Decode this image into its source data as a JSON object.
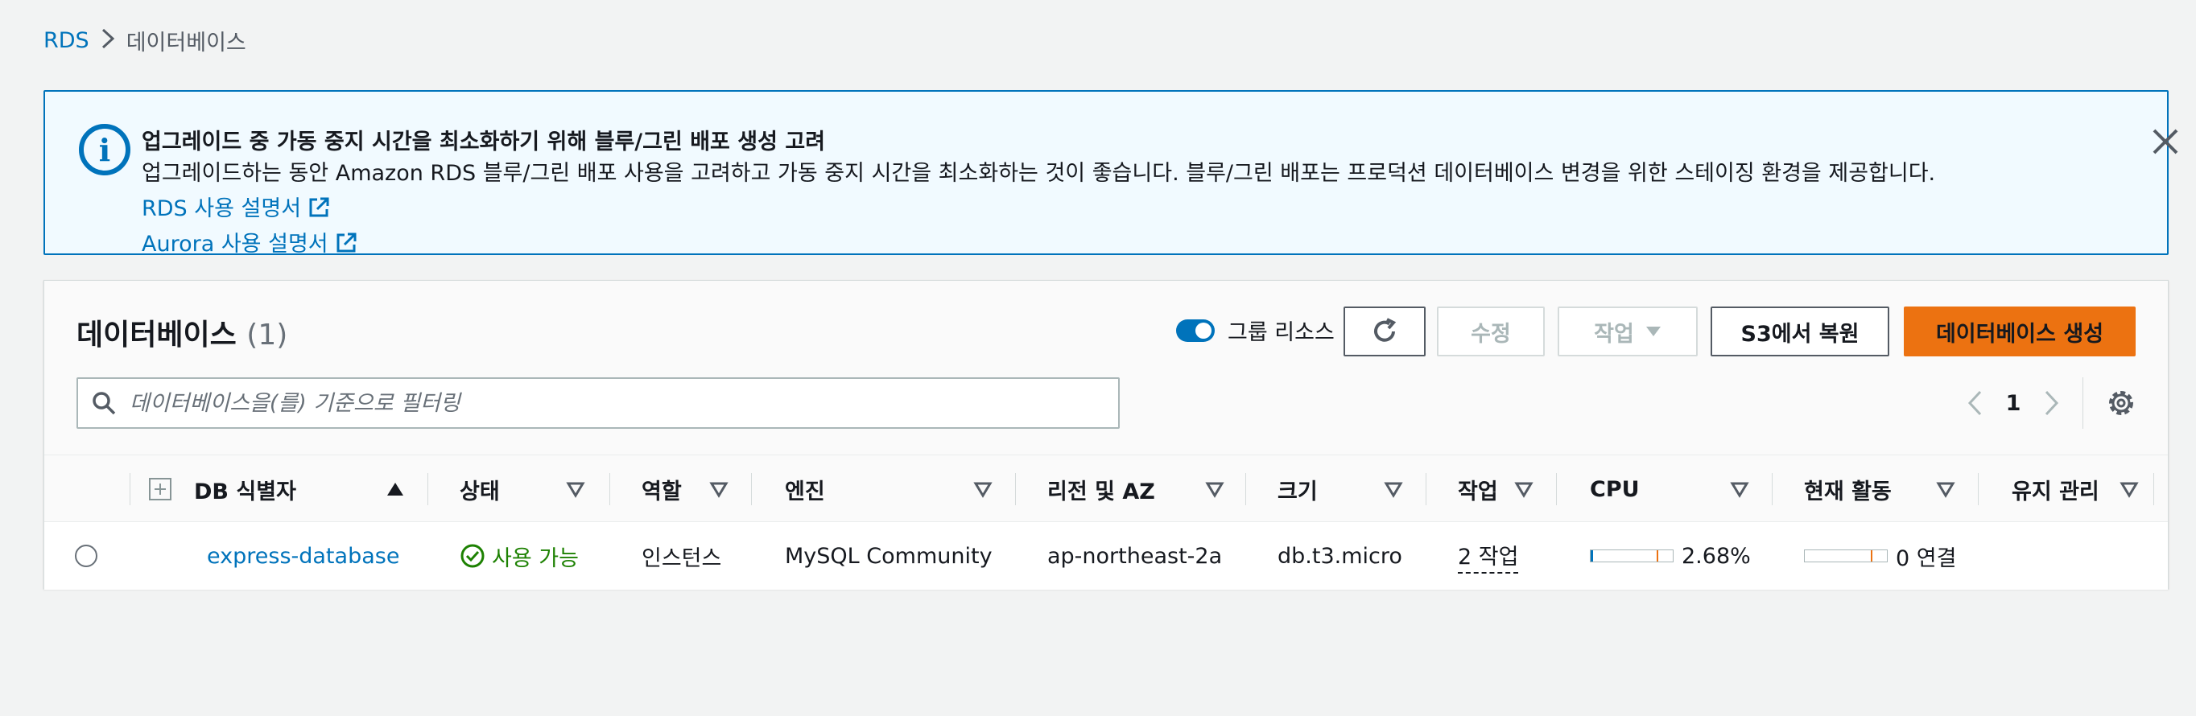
{
  "breadcrumb": {
    "root": "RDS",
    "current": "데이터베이스"
  },
  "banner": {
    "title": "업그레이드 중 가동 중지 시간을 최소화하기 위해 블루/그린 배포 생성 고려",
    "body": "업그레이드하는 동안 Amazon RDS 블루/그린 배포 사용을 고려하고 가동 중지 시간을 최소화하는 것이 좋습니다. 블루/그린 배포는 프로덕션 데이터베이스 변경을 위한 스테이징 환경을 제공합니다.",
    "rds_link": "RDS 사용 설명서",
    "aurora_link": "Aurora 사용 설명서"
  },
  "panel": {
    "title": "데이터베이스",
    "count": "(1)",
    "group_toggle_label": "그룹 리소스",
    "group_toggle_on": true,
    "buttons": {
      "modify": "수정",
      "actions": "작업",
      "restore_s3": "S3에서 복원",
      "create": "데이터베이스 생성"
    },
    "search_placeholder": "데이터베이스을(를) 기준으로 필터링",
    "page": "1"
  },
  "table": {
    "columns": {
      "identifier": "DB 식별자",
      "status": "상태",
      "role": "역할",
      "engine": "엔진",
      "region": "리전 및 AZ",
      "size": "크기",
      "actions": "작업",
      "cpu": "CPU",
      "activity": "현재 활동",
      "maintenance": "유지 관리"
    },
    "rows": [
      {
        "identifier": "express-database",
        "status": "사용 가능",
        "role": "인스턴스",
        "engine": "MySQL Community",
        "region": "ap-northeast-2a",
        "size": "db.t3.micro",
        "actions": "2 작업",
        "cpu": "2.68%",
        "cpu_fraction": 0.0268,
        "activity": "0 연결",
        "maintenance": ""
      }
    ]
  },
  "colors": {
    "link": "#0073bb",
    "primary": "#ec7211",
    "success": "#1d8102"
  }
}
